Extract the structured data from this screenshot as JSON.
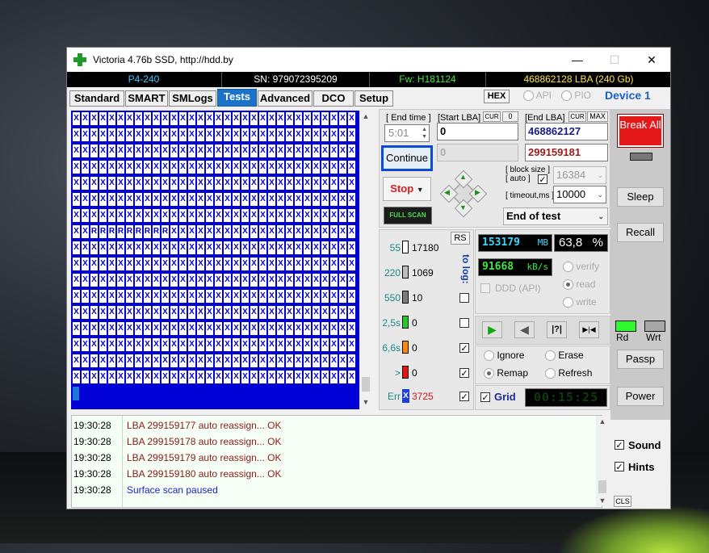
{
  "window": {
    "title": "Victoria 4.76b SSD, http://hdd.by",
    "minimize_symbol": "—",
    "maximize_symbol": "☐",
    "close_symbol": "✕"
  },
  "info": {
    "model": "P4-240",
    "serial": "SN: 979072395209",
    "firmware": "Fw: H181124",
    "capacity": "468862128 LBA (240 Gb)"
  },
  "tabs": [
    "Standard",
    "SMART",
    "SMLogs",
    "Tests",
    "Advanced",
    "DCO",
    "Setup"
  ],
  "active_tab": "Tests",
  "header_extra": {
    "hex": "HEX",
    "api": "API",
    "pio": "PIO",
    "device": "Device 1"
  },
  "grid": {
    "cols": 32,
    "rows": 17,
    "cell_char": "X",
    "alt_char": "R",
    "alt_row": 7,
    "alt_from_col": 2,
    "alt_to_col": 10
  },
  "params": {
    "end_time_label": "[ End time ]",
    "end_time": "5:01",
    "start_lba_label": "[Start LBA]",
    "cur": "CUR",
    "zero": "0",
    "start_lba": "0",
    "end_lba_label": "[End LBA]",
    "max": "MAX",
    "end_lba": "468862127",
    "current_lba": "0",
    "current_end": "299159181",
    "continue": "Continue",
    "stop": "Stop",
    "full_scan": "FULL SCAN",
    "block_size_label": "[ block size ]",
    "auto_label": "[ auto ]",
    "block_size": "16384",
    "timeout_label": "[ timeout,ms ]",
    "timeout": "10000",
    "end_action": "End of test"
  },
  "stats": {
    "rs": "RS",
    "to_log": "to log:",
    "rows": [
      {
        "time": "55",
        "count": "17180",
        "color": "#ffffff",
        "logged": false
      },
      {
        "time": "220",
        "count": "1069",
        "color": "#bdbdbd",
        "logged": false
      },
      {
        "time": "550",
        "count": "10",
        "color": "#7d7d7d",
        "logged": false
      },
      {
        "time": "2,5s",
        "count": "0",
        "color": "#22cc22",
        "logged": false
      },
      {
        "time": "6,6s",
        "count": "0",
        "color": "#ff8a00",
        "logged": true
      },
      {
        "time": ">",
        "count": "0",
        "color": "#ee1111",
        "logged": true
      }
    ],
    "err_label": "Err",
    "err_icon": "X",
    "err_count": "3725",
    "err_logged": true
  },
  "progress": {
    "mb": "153179",
    "mb_unit": "MB",
    "percent": "63,8",
    "percent_unit": "%",
    "speed": "91668",
    "speed_unit": "kB/s",
    "ddd": "DDD (API)",
    "verify": "verify",
    "read": "read",
    "write": "write"
  },
  "transport": {
    "play": "▶",
    "back": "◀",
    "skip": "|?|",
    "end": "▶|◀"
  },
  "actions": {
    "ignore": "Ignore",
    "erase": "Erase",
    "remap": "Remap",
    "refresh": "Refresh",
    "grid_label": "Grid",
    "timer": "00:15:25"
  },
  "side": {
    "break": "Break All",
    "sleep": "Sleep",
    "recall": "Recall",
    "rd": "Rd",
    "wrt": "Wrt",
    "passp": "Passp",
    "power": "Power",
    "sound": "Sound",
    "hints": "Hints",
    "cls": "CLS"
  },
  "log": [
    {
      "time": "19:30:28",
      "msg": "LBA 299159177 auto reassign... OK",
      "color": "#8b1a1a"
    },
    {
      "time": "19:30:28",
      "msg": "LBA 299159178 auto reassign... OK",
      "color": "#8b1a1a"
    },
    {
      "time": "19:30:28",
      "msg": "LBA 299159179 auto reassign... OK",
      "color": "#8b1a1a"
    },
    {
      "time": "19:30:28",
      "msg": "LBA 299159180 auto reassign... OK",
      "color": "#8b1a1a"
    },
    {
      "time": "19:30:28",
      "msg": "Surface scan paused",
      "color": "#1a22cc"
    }
  ]
}
